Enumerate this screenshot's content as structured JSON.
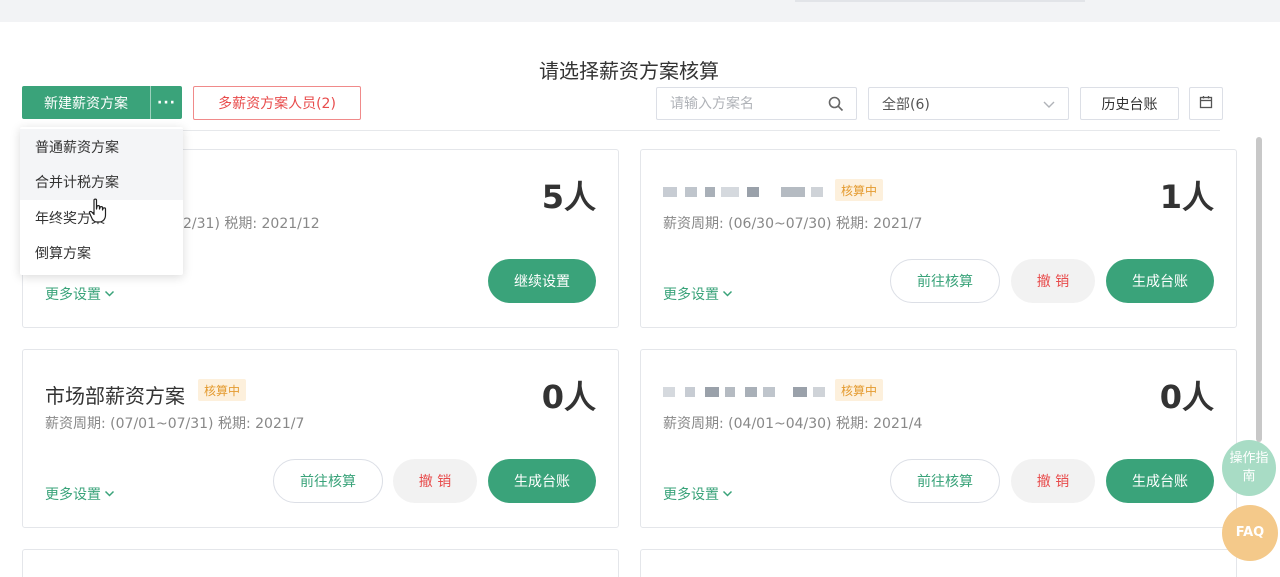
{
  "page_title": "请选择薪资方案核算",
  "toolbar": {
    "new_plan_label": "新建薪资方案",
    "more_label": "···",
    "multi_plan_label": "多薪资方案人员(2)",
    "search_placeholder": "请输入方案名",
    "filter_value": "全部(6)",
    "history_label": "历史台账"
  },
  "dropdown": {
    "items": [
      "普通薪资方案",
      "合并计税方案",
      "年终奖方案",
      "倒算方案"
    ]
  },
  "cards": [
    {
      "count": "5人",
      "period": "2/31)  税期: 2021/12",
      "more_settings": "更多设置",
      "continue_label": "继续设置"
    },
    {
      "tag": "核算中",
      "count": "1人",
      "period": "薪资周期: (06/30~07/30)  税期: 2021/7",
      "more_settings": "更多设置",
      "go_label": "前往核算",
      "cancel_label": "撤 销",
      "generate_label": "生成台账"
    },
    {
      "name": "市场部薪资方案",
      "tag": "核算中",
      "count": "0人",
      "period": "薪资周期: (07/01~07/31)  税期: 2021/7",
      "more_settings": "更多设置",
      "go_label": "前往核算",
      "cancel_label": "撤 销",
      "generate_label": "生成台账"
    },
    {
      "tag": "核算中",
      "count": "0人",
      "period": "薪资周期: (04/01~04/30)  税期: 2021/4",
      "more_settings": "更多设置",
      "go_label": "前往核算",
      "cancel_label": "撤 销",
      "generate_label": "生成台账"
    }
  ],
  "floating": {
    "guide_label": "操作指南",
    "faq_label": "FAQ"
  },
  "colors": {
    "primary": "#3aa37a",
    "danger": "#e84c4c",
    "tag_bg": "#fdf0dc",
    "tag_text": "#e49b30"
  }
}
